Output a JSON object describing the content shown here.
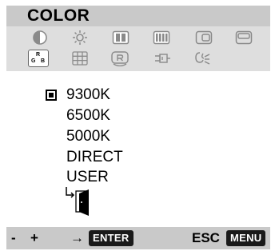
{
  "title": "COLOR",
  "icon_row1": [
    "contrast-icon",
    "brightness-icon",
    "h-position-icon",
    "v-position-icon",
    "h-size-icon",
    "v-size-icon"
  ],
  "icon_row2": [
    "rgb-color-icon",
    "grid-geometry-icon",
    "reset-icon",
    "degauss-icon",
    "language-icon"
  ],
  "rgb_icon_letters": {
    "top": "R",
    "left": "G",
    "right": "B"
  },
  "options": [
    "9300K",
    "6500K",
    "5000K",
    "DIRECT",
    "USER"
  ],
  "selected_option": "9300K",
  "exit_icon": "exit-door-icon",
  "footer": {
    "minus": "-",
    "plus": "+",
    "arrow": "→",
    "enter": "ENTER",
    "esc": "ESC",
    "menu": "MENU"
  },
  "colors": {
    "panel": "#dedede",
    "bar": "#c9c9c9",
    "key_bg": "#1a1a1a",
    "icon_stroke": "#8a8a8a"
  }
}
